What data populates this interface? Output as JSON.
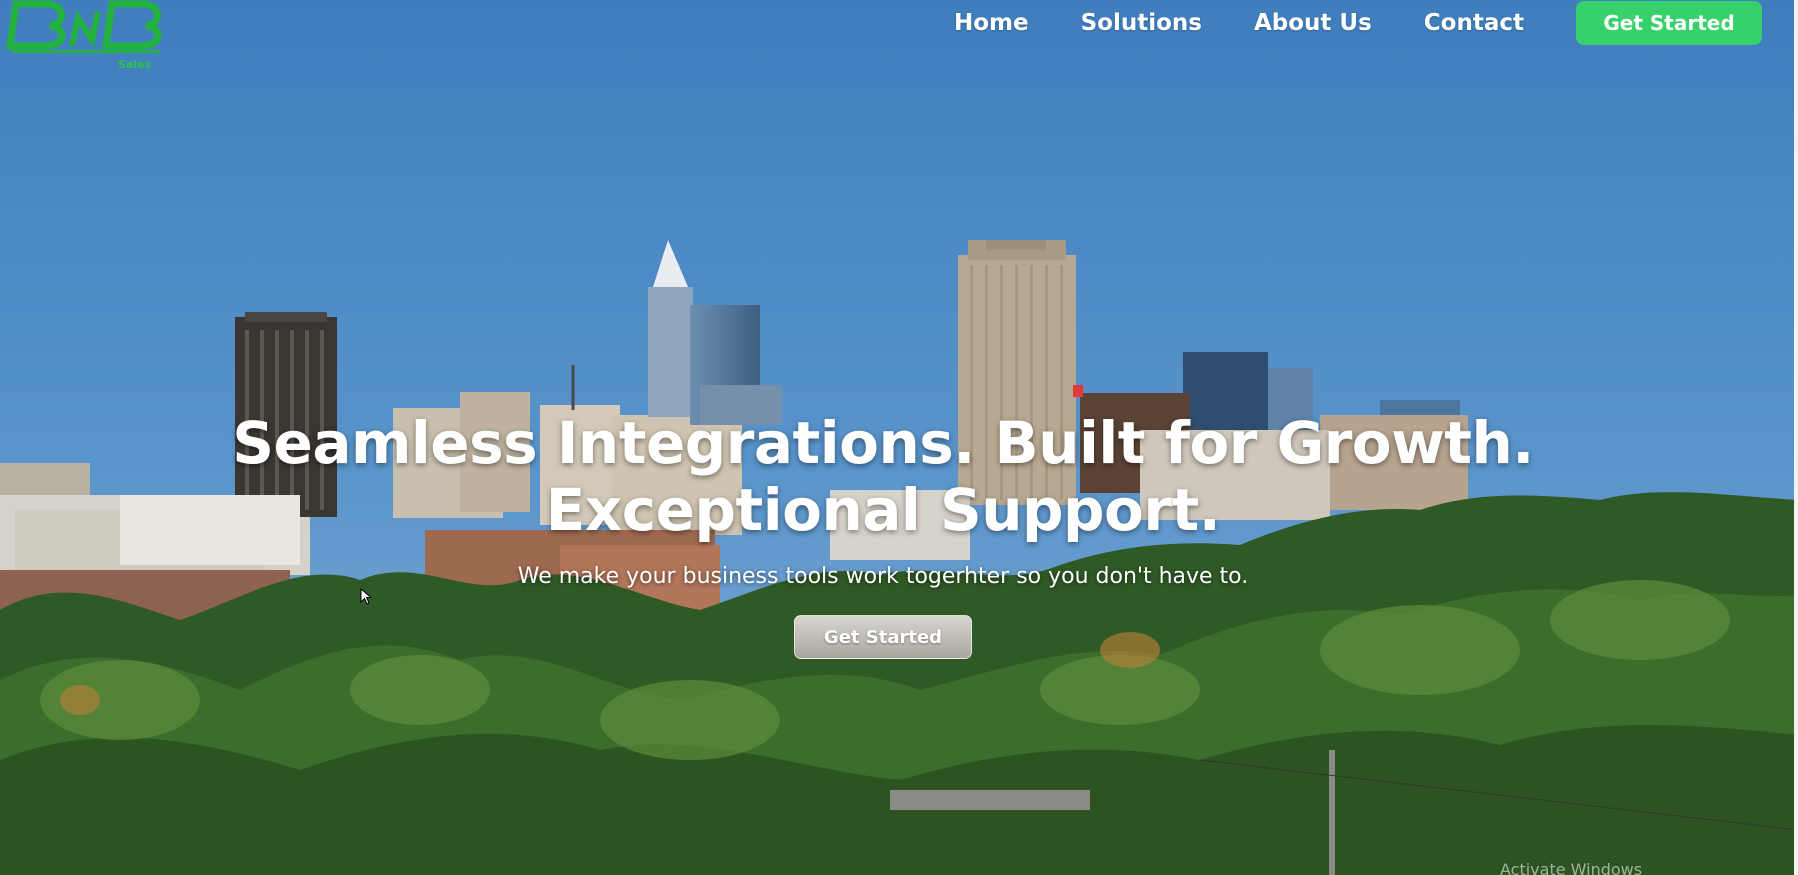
{
  "brand": {
    "logo_name": "logo",
    "tagline": "Sales"
  },
  "nav": {
    "links": [
      "Home",
      "Solutions",
      "About Us",
      "Contact"
    ],
    "cta_label": "Get Started"
  },
  "hero": {
    "title_line1": "Seamless Integrations. Built for Growth.",
    "title_line2": "Exceptional Support.",
    "subtitle": "We make your business tools work togerhter so you don't have to.",
    "cta_label": "Get Started"
  },
  "os_overlay": {
    "text": "Activate Windows"
  },
  "colors": {
    "accent_green": "#36d16a",
    "logo_green": "#2fc24a",
    "sky": "#4a86c2"
  }
}
